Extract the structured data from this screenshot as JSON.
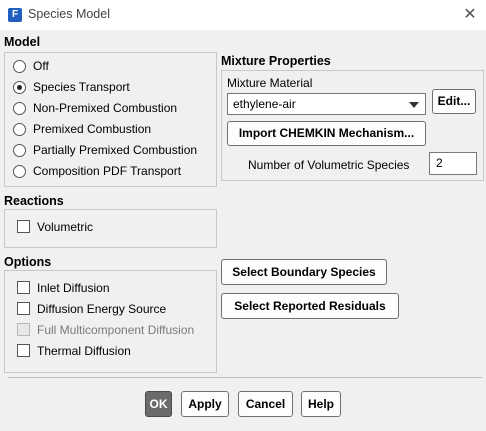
{
  "window": {
    "title": "Species Model",
    "app_icon_letter": "F",
    "close_glyph": "✕"
  },
  "model": {
    "heading": "Model",
    "options": [
      {
        "label": "Off",
        "selected": false
      },
      {
        "label": "Species Transport",
        "selected": true
      },
      {
        "label": "Non-Premixed Combustion",
        "selected": false
      },
      {
        "label": "Premixed Combustion",
        "selected": false
      },
      {
        "label": "Partially Premixed Combustion",
        "selected": false
      },
      {
        "label": "Composition PDF Transport",
        "selected": false
      }
    ]
  },
  "mixture": {
    "heading": "Mixture Properties",
    "material_label": "Mixture Material",
    "material_value": "ethylene-air",
    "edit_button": "Edit...",
    "import_button": "Import CHEMKIN Mechanism...",
    "volumetric_species_label": "Number of Volumetric Species",
    "volumetric_species_value": "2"
  },
  "reactions": {
    "heading": "Reactions",
    "options": [
      {
        "label": "Volumetric",
        "checked": false
      }
    ]
  },
  "options": {
    "heading": "Options",
    "items": [
      {
        "label": "Inlet Diffusion",
        "checked": false,
        "enabled": true
      },
      {
        "label": "Diffusion Energy Source",
        "checked": false,
        "enabled": true
      },
      {
        "label": "Full Multicomponent Diffusion",
        "checked": false,
        "enabled": false
      },
      {
        "label": "Thermal Diffusion",
        "checked": false,
        "enabled": true
      }
    ],
    "select_boundary_button": "Select Boundary Species",
    "select_residuals_button": "Select Reported Residuals"
  },
  "footer": {
    "ok": "OK",
    "apply": "Apply",
    "cancel": "Cancel",
    "help": "Help"
  }
}
